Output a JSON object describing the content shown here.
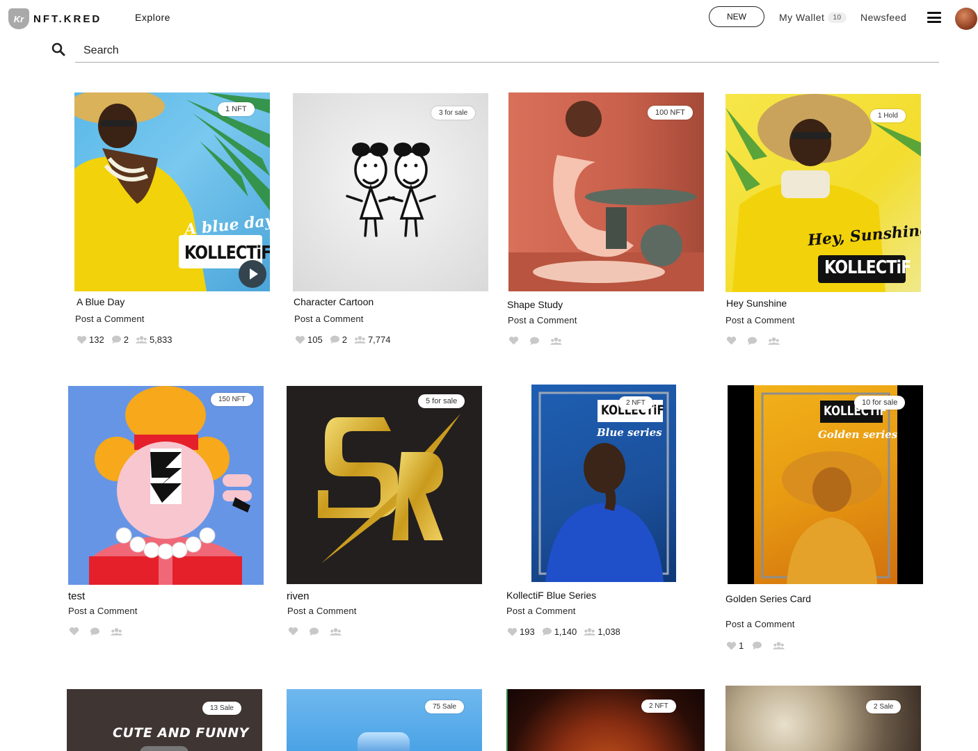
{
  "header": {
    "logo_text": "NFT.KRED",
    "logo_mark": "Kr",
    "explore": "Explore",
    "new_button": "NEW",
    "wallet_label": "My Wallet",
    "wallet_count": "10",
    "newsfeed": "Newsfeed"
  },
  "search": {
    "placeholder": "Search"
  },
  "cards": [
    {
      "title": "A Blue Day",
      "badge": "1 NFT",
      "comment": "Post a Comment",
      "likes": "132",
      "comments": "2",
      "views": "5,833",
      "art_text": [
        "A blue day",
        "KOLLECTiF"
      ]
    },
    {
      "title": "Character Cartoon",
      "badge": "3 for sale",
      "comment": "Post a Comment",
      "likes": "105",
      "comments": "2",
      "views": "7,774"
    },
    {
      "title": "Shape Study",
      "badge": "100 NFT",
      "comment": "Post a Comment",
      "likes": "",
      "comments": "",
      "views": ""
    },
    {
      "title": "Hey Sunshine",
      "badge": "1 Hold",
      "comment": "Post a Comment",
      "likes": "",
      "comments": "",
      "views": "",
      "art_text": [
        "Hey, Sunshine!",
        "KOLLECTiF"
      ]
    },
    {
      "title": "test",
      "badge": "150 NFT",
      "comment": "Post a Comment",
      "likes": "",
      "comments": "",
      "views": ""
    },
    {
      "title": "riven",
      "badge": "5 for sale",
      "comment": "Post a Comment",
      "likes": "",
      "comments": "",
      "views": ""
    },
    {
      "title": "KollectiF Blue Series",
      "badge": "2 NFT",
      "comment": "Post a Comment",
      "likes": "193",
      "comments": "1,140",
      "views": "1,038",
      "art_text": [
        "KOLLECTiF",
        "Blue series"
      ]
    },
    {
      "title": "Golden Series Card",
      "badge": "10 for sale",
      "comment": "Post a Comment",
      "likes": "1",
      "comments": "",
      "views": "",
      "art_text": [
        "KOLLECTiF",
        "Golden series"
      ]
    },
    {
      "title": "",
      "badge": "13 Sale",
      "art_text": [
        "CUTE AND FUNNY"
      ]
    },
    {
      "title": "",
      "badge": "75 Sale"
    },
    {
      "title": "",
      "badge": "2 NFT"
    },
    {
      "title": "",
      "badge": "2 Sale"
    }
  ],
  "colors": {
    "accent": "#111111",
    "badge_bg": "#ffffff",
    "stat_icon": "#c8c8c8"
  },
  "icons": {
    "like": "heart-icon",
    "comment": "comment-icon",
    "views": "users-icon",
    "search": "search-icon",
    "menu": "hamburger-menu-icon",
    "play": "play-icon"
  }
}
